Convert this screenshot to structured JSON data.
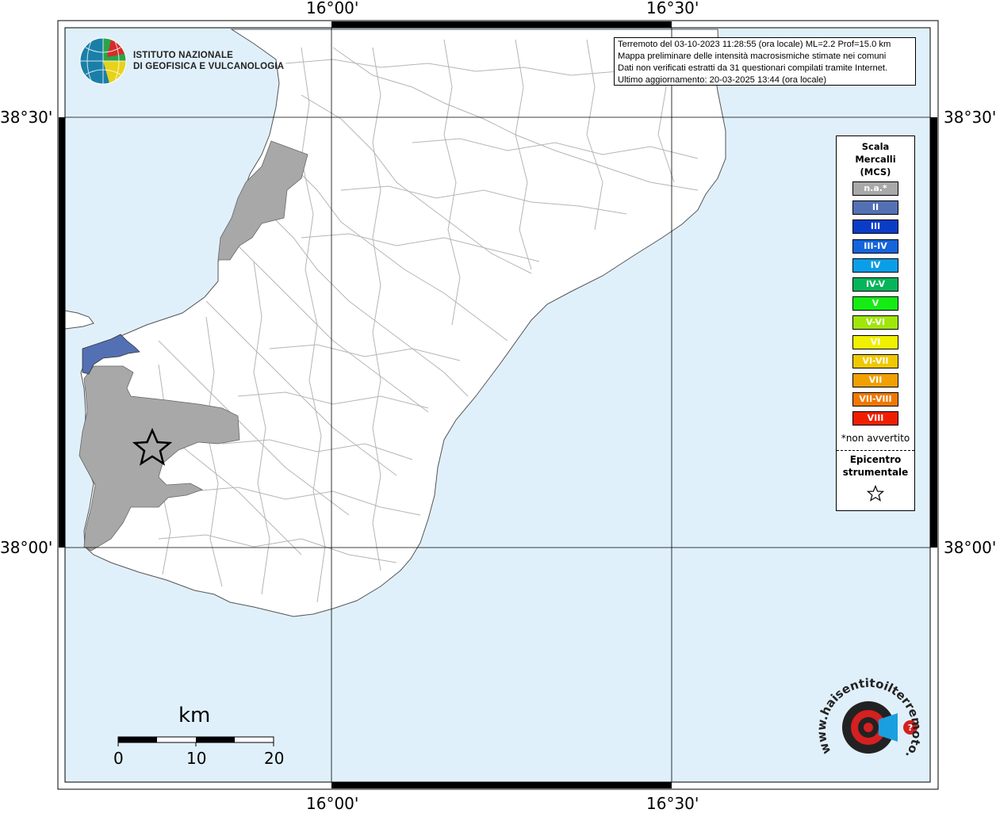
{
  "coordinates": {
    "top_left": "16°00'",
    "top_right": "16°30'",
    "bottom_left": "16°00'",
    "bottom_right": "16°30'",
    "left_upper": "38°30'",
    "left_lower": "38°00'",
    "right_upper": "38°30'",
    "right_lower": "38°00'"
  },
  "logo_ingv": {
    "line1": "ISTITUTO NAZIONALE",
    "line2": "DI GEOFISICA E VULCANOLOGIA"
  },
  "info": {
    "line1": "Terremoto del 03-10-2023 11:28:55 (ora locale) ML=2.2 Prof=15.0 km",
    "line2": "Mappa preliminare delle intensità macrosismiche stimate nei comuni",
    "line3": "Dati non verificati estratti da 31 questionari compilati tramite Internet.",
    "line4": "Ultimo aggiornamento: 20-03-2025 13:44 (ora locale)"
  },
  "legend": {
    "title1": "Scala",
    "title2": "Mercalli",
    "title3": "(MCS)",
    "items": [
      {
        "label": "n.a.*",
        "color": "#a8a8a8"
      },
      {
        "label": "II",
        "color": "#5470b4"
      },
      {
        "label": "III",
        "color": "#0a3cc8"
      },
      {
        "label": "III-IV",
        "color": "#1464dc"
      },
      {
        "label": "IV",
        "color": "#0a9ee8"
      },
      {
        "label": "IV-V",
        "color": "#06b45a"
      },
      {
        "label": "V",
        "color": "#14ec14"
      },
      {
        "label": "V-VI",
        "color": "#a0e60a"
      },
      {
        "label": "VI",
        "color": "#f0f000"
      },
      {
        "label": "VI-VII",
        "color": "#f0c800"
      },
      {
        "label": "VII",
        "color": "#f0a000"
      },
      {
        "label": "VII-VIII",
        "color": "#f07800"
      },
      {
        "label": "VIII",
        "color": "#f01e00"
      }
    ],
    "note": "*non avvertito",
    "epicenter1": "Epicentro",
    "epicenter2": "strumentale"
  },
  "scale_bar": {
    "unit": "km",
    "ticks": [
      "0",
      "10",
      "20"
    ]
  },
  "logo_hsit": {
    "text": "www.haisentitoilterremoto.it"
  },
  "colors": {
    "sea": "#e0f0fb",
    "land": "#ffffff",
    "felt_na": "#a8a8a8",
    "felt_ii": "#5470b4",
    "grid": "#000000"
  }
}
